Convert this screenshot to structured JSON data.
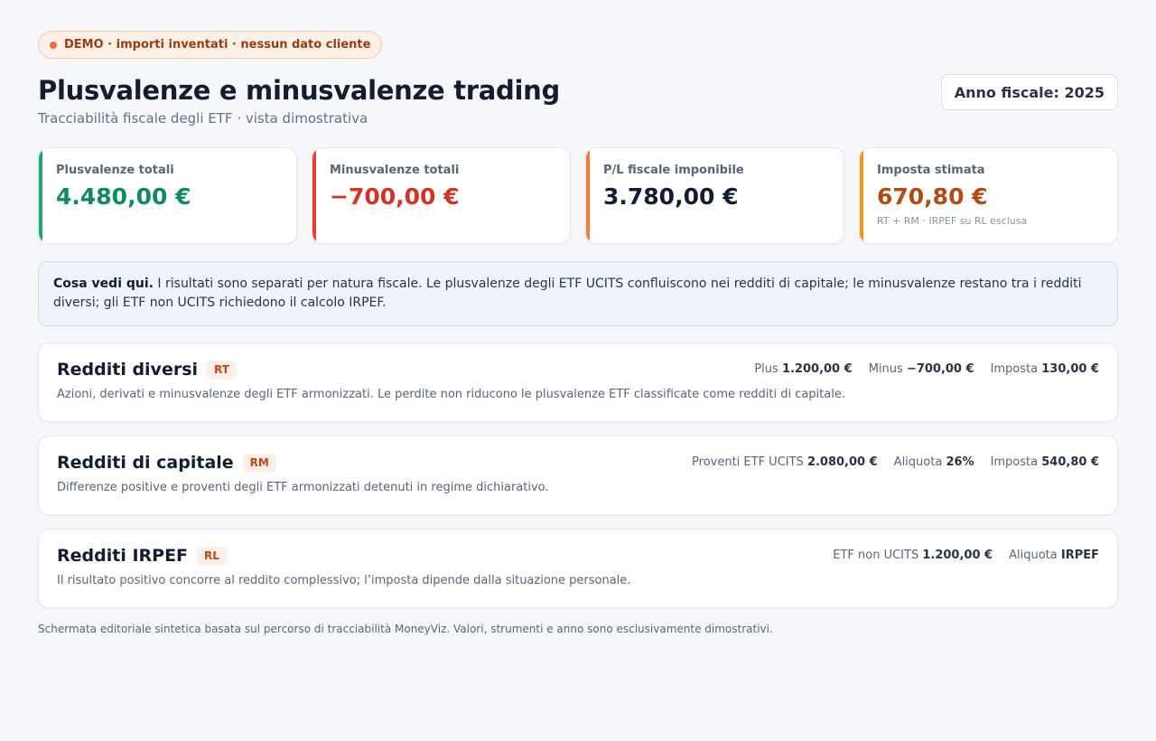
{
  "badge": {
    "text": "DEMO · importi inventati · nessun dato cliente"
  },
  "header": {
    "title": "Plusvalenze e minusvalenze trading",
    "subtitle": "Tracciabilità fiscale degli ETF · vista dimostrativa",
    "year_label": "Anno fiscale: 2025"
  },
  "kpis": [
    {
      "label": "Plusvalenze totali",
      "value": "4.480,00 €",
      "color": "#0f8a5f",
      "accent": "#1faa74",
      "note": ""
    },
    {
      "label": "Minusvalenze totali",
      "value": "−700,00 €",
      "color": "#d23325",
      "accent": "#e2412f",
      "note": ""
    },
    {
      "label": "P/L fiscale imponibile",
      "value": "3.780,00 €",
      "color": "#141c30",
      "accent": "#f27a3b",
      "note": ""
    },
    {
      "label": "Imposta stimata",
      "value": "670,80 €",
      "color": "#b04c10",
      "accent": "#ef961f",
      "note": "RT + RM · IRPEF su RL esclusa"
    }
  ],
  "info": {
    "lead": "Cosa vedi qui.",
    "text": " I risultati sono separati per natura fiscale. Le plusvalenze degli ETF UCITS confluiscono nei redditi di capitale; le minusvalenze restano tra i redditi diversi; gli ETF non UCITS richiedono il calcolo IRPEF."
  },
  "sections": [
    {
      "title": "Redditi diversi",
      "tag": "RT",
      "stats": [
        {
          "label": "Plus",
          "value": "1.200,00 €"
        },
        {
          "label": "Minus",
          "value": "−700,00 €"
        },
        {
          "label": "Imposta",
          "value": "130,00 €"
        }
      ],
      "desc": "Azioni, derivati e minusvalenze degli ETF armonizzati. Le perdite non riducono le plusvalenze ETF classificate come redditi di capitale."
    },
    {
      "title": "Redditi di capitale",
      "tag": "RM",
      "stats": [
        {
          "label": "Proventi ETF UCITS",
          "value": "2.080,00 €"
        },
        {
          "label": "Aliquota",
          "value": "26%"
        },
        {
          "label": "Imposta",
          "value": "540,80 €"
        }
      ],
      "desc": "Differenze positive e proventi degli ETF armonizzati detenuti in regime dichiarativo."
    },
    {
      "title": "Redditi IRPEF",
      "tag": "RL",
      "stats": [
        {
          "label": "ETF non UCITS",
          "value": "1.200,00 €"
        },
        {
          "label": "Aliquota",
          "value": "IRPEF"
        }
      ],
      "desc": "Il risultato positivo concorre al reddito complessivo; l’imposta dipende dalla situazione personale."
    }
  ],
  "footer": "Schermata editoriale sintetica basata sul percorso di tracciabilità MoneyViz. Valori, strumenti e anno sono esclusivamente dimostrativi."
}
